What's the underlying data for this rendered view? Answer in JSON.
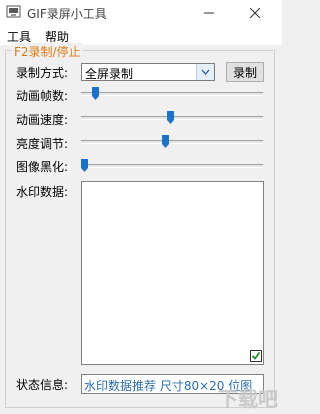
{
  "window": {
    "title": "GIF录屏小工具"
  },
  "menu": [
    "工具",
    "帮助"
  ],
  "group": {
    "legend": "F2录制/停止"
  },
  "recording": {
    "mode_label": "录制方式:",
    "mode_value": "全屏录制",
    "record_button": "录制"
  },
  "sliders": [
    {
      "label": "动画帧数:",
      "value_fraction": 0.06
    },
    {
      "label": "动画速度:",
      "value_fraction": 0.49
    },
    {
      "label": "亮度调节:",
      "value_fraction": 0.46
    },
    {
      "label": "图像黑化:",
      "value_fraction": 0.0
    }
  ],
  "watermark_text": {
    "label": "水印数据:",
    "value": ""
  },
  "checkbox": {
    "checked": true
  },
  "status": {
    "label": "状态信息:",
    "value": "水印数据推荐 尺寸80×20 位图"
  },
  "site_watermark": "下载吧"
}
